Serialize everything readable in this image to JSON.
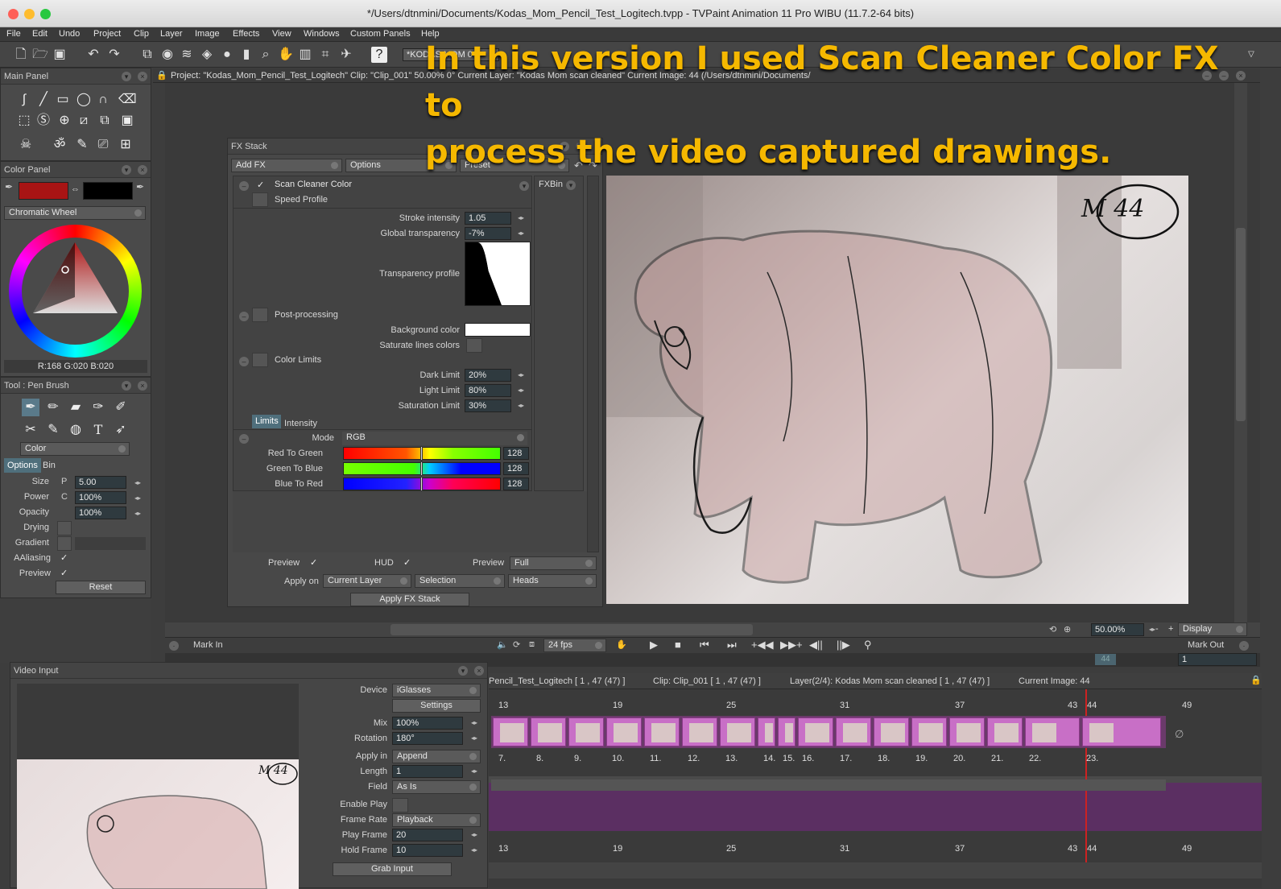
{
  "window": {
    "title": "*/Users/dtnmini/Documents/Kodas_Mom_Pencil_Test_Logitech.tvpp - TVPaint Animation 11 Pro WIBU (11.7.2-64 bits)"
  },
  "menu": [
    "File",
    "Edit",
    "Undo",
    "Project",
    "Clip",
    "Layer",
    "Image",
    "Effects",
    "View",
    "Windows",
    "Custom Panels",
    "Help"
  ],
  "toolbar": {
    "layer_field": "*KODAS MOM 00"
  },
  "overlay": {
    "line1": "In this version I used Scan Cleaner Color FX to",
    "line2": "process the video captured drawings.",
    "color": "#f5b800"
  },
  "status_bar": "Project: \"Kodas_Mom_Pencil_Test_Logitech\"  Clip: \"Clip_001\"  50.00%  0°  Current Layer: \"Kodas Mom scan cleaned\"  Current Image: 44  (/Users/dtnmini/Documents/",
  "main_panel": {
    "title": "Main Panel"
  },
  "color_panel": {
    "title": "Color Panel",
    "mode": "Chromatic Wheel",
    "readout": "R:168 G:020 B:020",
    "primary": "#a81414",
    "secondary": "#000000"
  },
  "tool_panel": {
    "title": "Tool : Pen Brush",
    "color_mode": "Color",
    "tabs": [
      "Options",
      "Bin"
    ],
    "rows": [
      {
        "label": "Size",
        "mode": "P",
        "value": "5.00"
      },
      {
        "label": "Power",
        "mode": "C",
        "value": "100%"
      },
      {
        "label": "Opacity",
        "mode": "",
        "value": "100%"
      }
    ],
    "drying": "Drying",
    "gradient": "Gradient",
    "aaliasing": "AAliasing",
    "preview": "Preview",
    "reset": "Reset"
  },
  "fx_stack": {
    "title": "FX Stack",
    "add_fx": "Add FX",
    "options": "Options",
    "preset": "Preset",
    "fxbin": "FXBin",
    "effect": "Scan Cleaner Color",
    "speed_profile": "Speed Profile",
    "stroke_intensity": {
      "label": "Stroke intensity",
      "value": "1.05"
    },
    "global_transparency": {
      "label": "Global transparency",
      "value": "-7%"
    },
    "transparency_profile": "Transparency profile",
    "post_processing": "Post-processing",
    "background_color": "Background color",
    "saturate": "Saturate lines colors",
    "color_limits": "Color Limits",
    "dark_limit": {
      "label": "Dark Limit",
      "value": "20%"
    },
    "light_limit": {
      "label": "Light Limit",
      "value": "80%"
    },
    "saturation_limit": {
      "label": "Saturation Limit",
      "value": "30%"
    },
    "tabs": [
      "Limits",
      "Intensity"
    ],
    "mode": {
      "label": "Mode",
      "value": "RGB"
    },
    "sliders": [
      {
        "label": "Red To Green",
        "value": "128"
      },
      {
        "label": "Green To Blue",
        "value": "128"
      },
      {
        "label": "Blue To Red",
        "value": "128"
      }
    ],
    "preview_label": "Preview",
    "hud_label": "HUD",
    "preview2_label": "Preview",
    "preview_value": "Full",
    "apply_on": "Apply on",
    "apply_layer": "Current Layer",
    "apply_selection": "Selection",
    "apply_heads": "Heads",
    "apply_button": "Apply FX Stack"
  },
  "canvas": {
    "annotation": "M 44"
  },
  "view_controls": {
    "zoom": "50.00%",
    "display": "Display",
    "minus": "-",
    "plus": "+"
  },
  "playback": {
    "mark_in": "Mark In",
    "fps": "24 fps",
    "mark_out": "Mark Out",
    "frame": "1",
    "timeline_marker": "44"
  },
  "timeline": {
    "header_project": "Pencil_Test_Logitech [ 1 , 47  (47) ]",
    "header_clip": "Clip: Clip_001 [ 1 , 47  (47) ]",
    "header_layer": "Layer(2/4): Kodas Mom scan cleaned [ 1 , 47  (47) ]",
    "header_current": "Current Image: 44",
    "ticks": [
      "13",
      "19",
      "25",
      "31",
      "37",
      "43",
      "44",
      "49"
    ],
    "frame_labels": [
      "7.",
      "8.",
      "9.",
      "10.",
      "11.",
      "12.",
      "13.",
      "14.",
      "15.",
      "16.",
      "17.",
      "18.",
      "19.",
      "20.",
      "21.",
      "22.",
      "23."
    ]
  },
  "video_input": {
    "title": "Video Input",
    "device": {
      "label": "Device",
      "value": "iGlasses"
    },
    "settings": "Settings",
    "mix": {
      "label": "Mix",
      "value": "100%"
    },
    "rotation": {
      "label": "Rotation",
      "value": "180°"
    },
    "apply_in": {
      "label": "Apply in",
      "value": "Append"
    },
    "length": {
      "label": "Length",
      "value": "1"
    },
    "field": {
      "label": "Field",
      "value": "As Is"
    },
    "enable_play": "Enable Play",
    "frame_rate": {
      "label": "Frame Rate",
      "value": "Playback"
    },
    "play_frame": {
      "label": "Play Frame",
      "value": "20"
    },
    "hold_frame": {
      "label": "Hold Frame",
      "value": "10"
    },
    "grab": "Grab Input",
    "thumb_annotation": "M 44"
  }
}
